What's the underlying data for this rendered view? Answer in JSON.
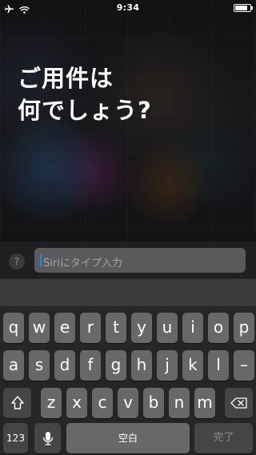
{
  "status_bar": {
    "time": "9:34",
    "icons": [
      "airplane-icon",
      "wifi-icon",
      "battery-icon"
    ],
    "battery_level": 0.85
  },
  "siri": {
    "prompt_line1": "ご用件は",
    "prompt_line2": "何でしょう?"
  },
  "input": {
    "help_label": "?",
    "placeholder": "Siriにタイプ入力"
  },
  "keyboard": {
    "row1": [
      "q",
      "w",
      "e",
      "r",
      "t",
      "y",
      "u",
      "i",
      "o",
      "p"
    ],
    "row2": [
      "a",
      "s",
      "d",
      "f",
      "g",
      "h",
      "j",
      "k",
      "l",
      "–"
    ],
    "row3": [
      "z",
      "x",
      "c",
      "v",
      "b",
      "n",
      "m"
    ],
    "numbers_label": "123",
    "space_label": "空白",
    "done_label": "完了",
    "icons": [
      "shift-icon",
      "delete-icon",
      "microphone-icon"
    ]
  },
  "colors": {
    "caret": "#2f7cf6",
    "key": "#686869",
    "key_dark": "#454546",
    "keyboard_bg": "#262628"
  }
}
